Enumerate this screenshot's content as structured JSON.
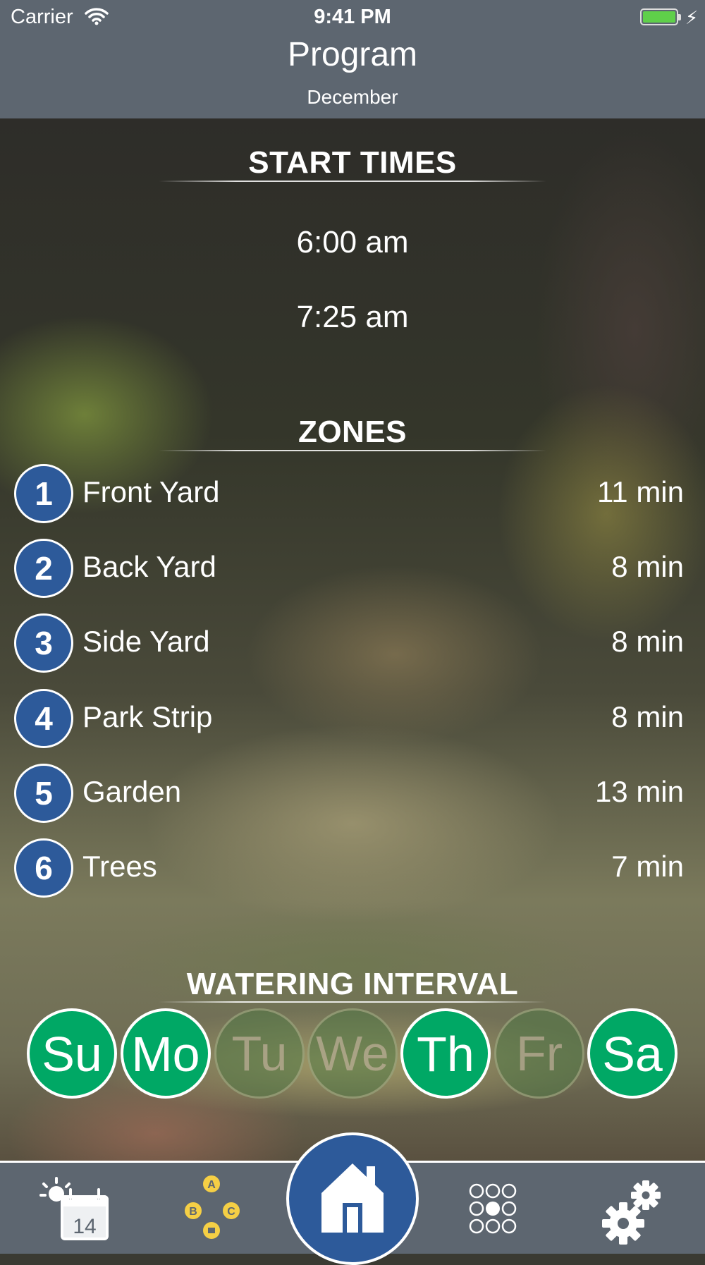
{
  "status_bar": {
    "carrier": "Carrier",
    "time": "9:41 PM",
    "battery_level": 1.0
  },
  "header": {
    "title": "Program",
    "subtitle": "December"
  },
  "start_times": {
    "title": "START TIMES",
    "items": [
      "6:00 am",
      "7:25 am"
    ]
  },
  "zones": {
    "title": "ZONES",
    "items": [
      {
        "number": "1",
        "name": "Front Yard",
        "duration": "11 min"
      },
      {
        "number": "2",
        "name": "Back Yard",
        "duration": "8 min"
      },
      {
        "number": "3",
        "name": "Side Yard",
        "duration": "8 min"
      },
      {
        "number": "4",
        "name": "Park Strip",
        "duration": "8 min"
      },
      {
        "number": "5",
        "name": "Garden",
        "duration": "13 min"
      },
      {
        "number": "6",
        "name": "Trees",
        "duration": "7 min"
      }
    ]
  },
  "watering_interval": {
    "title": "WATERING INTERVAL",
    "days": [
      {
        "label": "Su",
        "active": true
      },
      {
        "label": "Mo",
        "active": true
      },
      {
        "label": "Tu",
        "active": false
      },
      {
        "label": "We",
        "active": false
      },
      {
        "label": "Th",
        "active": true
      },
      {
        "label": "Fr",
        "active": false
      },
      {
        "label": "Sa",
        "active": true
      }
    ]
  },
  "tab_bar": {
    "calendar_day": "14",
    "program_letters": [
      "A",
      "B",
      "C"
    ],
    "icons": [
      "weather-calendar-icon",
      "programs-abc-icon",
      "home-icon",
      "zones-grid-icon",
      "settings-gears-icon"
    ]
  },
  "colors": {
    "header_bg": "#5d6670",
    "zone_badge": "#2d5a9a",
    "day_active": "#00a865",
    "program_letter": "#f5cf45"
  }
}
